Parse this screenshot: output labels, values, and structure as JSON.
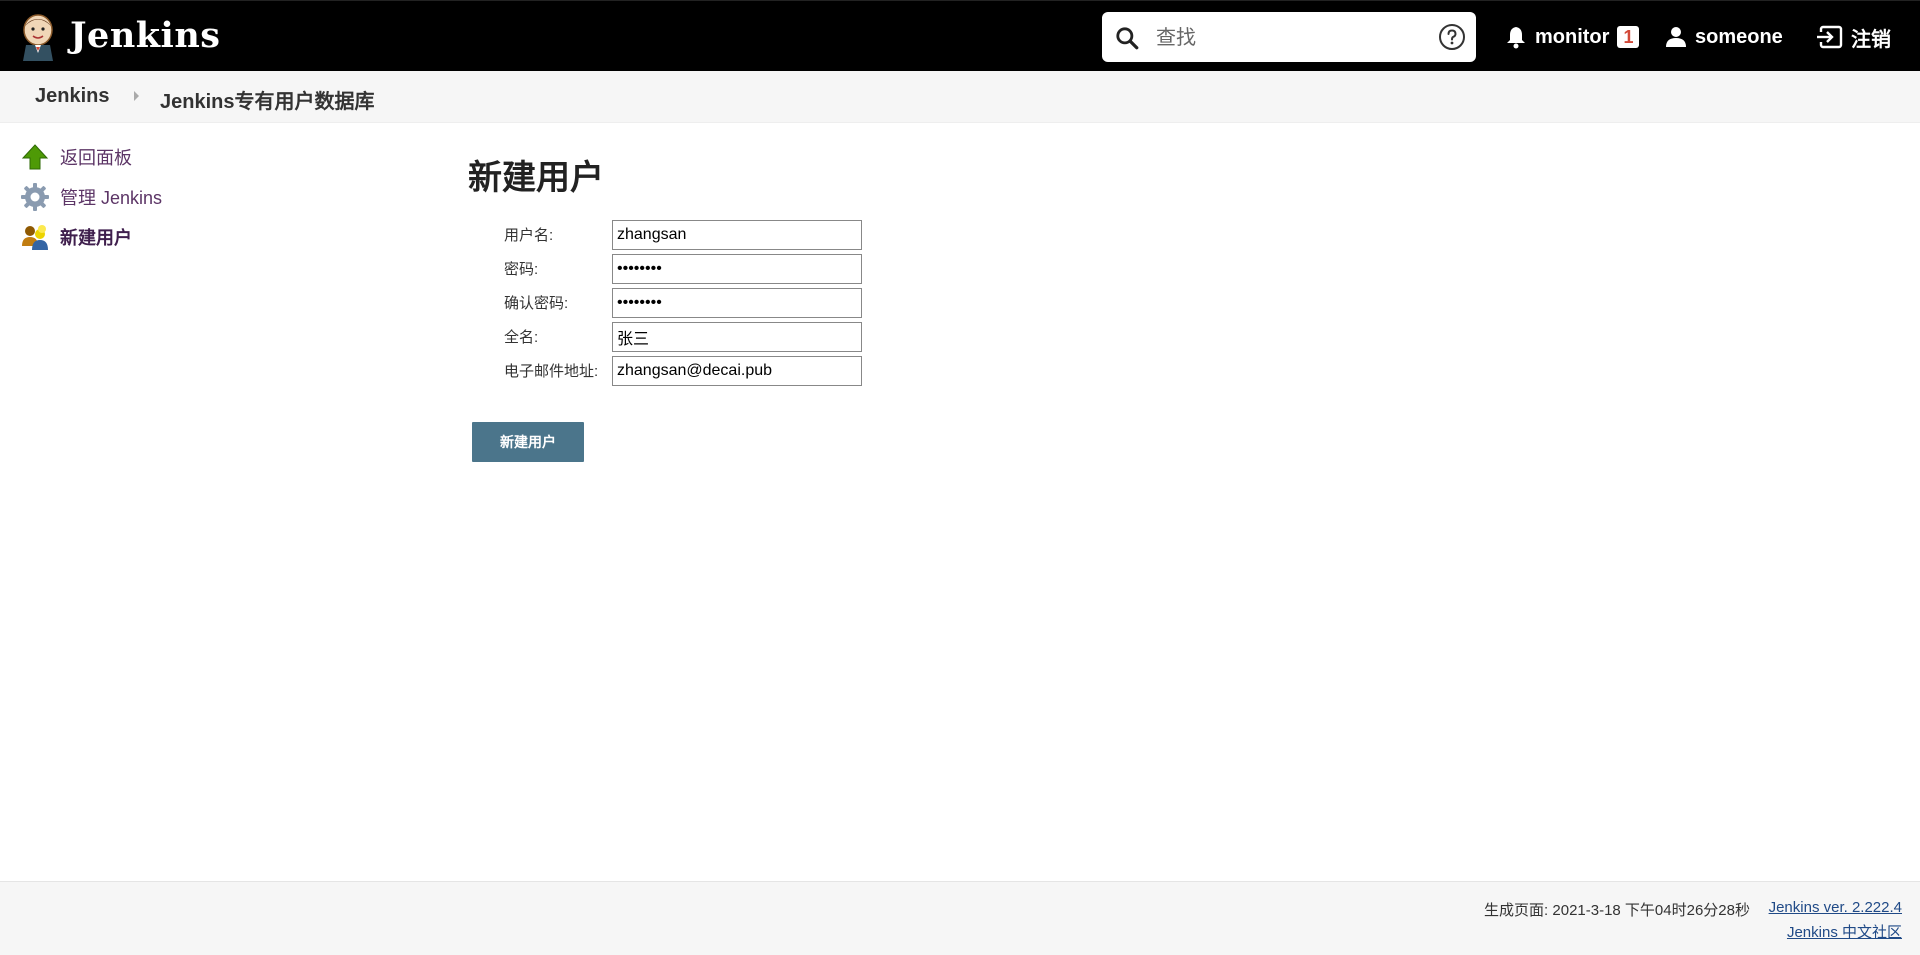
{
  "header": {
    "brand": "Jenkins",
    "search_placeholder": "查找",
    "monitor_label": "monitor",
    "monitor_count": "1",
    "user_label": "someone",
    "logout_label": "注销"
  },
  "breadcrumb": {
    "items": [
      "Jenkins",
      "Jenkins专有用户数据库"
    ]
  },
  "sidebar": {
    "items": [
      {
        "label": "返回面板",
        "icon": "up-arrow-icon"
      },
      {
        "label": "管理 Jenkins",
        "icon": "gear-icon"
      },
      {
        "label": "新建用户",
        "icon": "users-icon"
      }
    ]
  },
  "main": {
    "title": "新建用户",
    "fields": [
      {
        "label": "用户名:",
        "value": "zhangsan",
        "type": "text"
      },
      {
        "label": "密码:",
        "value": "••••••••",
        "type": "password"
      },
      {
        "label": "确认密码:",
        "value": "••••••••",
        "type": "password"
      },
      {
        "label": "全名:",
        "value": "张三",
        "type": "text"
      },
      {
        "label": "电子邮件地址:",
        "value": "zhangsan@decai.pub",
        "type": "text"
      }
    ],
    "submit_label": "新建用户"
  },
  "footer": {
    "generated": "生成页面: 2021-3-18 下午04时26分28秒",
    "version_link": "Jenkins ver. 2.222.4",
    "community_link": "Jenkins 中文社区"
  },
  "colors": {
    "header_bg": "#000000",
    "button_bg": "#4b758b",
    "link": "#5c3566",
    "badge_text": "#d24939"
  }
}
